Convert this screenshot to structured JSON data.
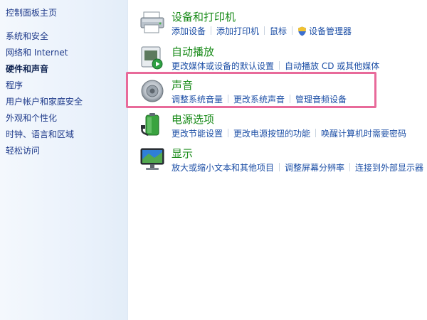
{
  "sidebar": {
    "home": "控制面板主页",
    "items": [
      {
        "label": "系统和安全"
      },
      {
        "label": "网络和 Internet"
      },
      {
        "label": "硬件和声音",
        "active": true
      },
      {
        "label": "程序"
      },
      {
        "label": "用户帐户和家庭安全"
      },
      {
        "label": "外观和个性化"
      },
      {
        "label": "时钟、语言和区域"
      },
      {
        "label": "轻松访问"
      }
    ]
  },
  "categories": {
    "devices": {
      "title": "设备和打印机",
      "icon": "printer-icon",
      "links": [
        "添加设备",
        "添加打印机",
        "鼠标",
        "设备管理器"
      ]
    },
    "autoplay": {
      "title": "自动播放",
      "icon": "autoplay-icon",
      "links": [
        "更改媒体或设备的默认设置",
        "自动播放 CD 或其他媒体"
      ]
    },
    "sound": {
      "title": "声音",
      "icon": "speaker-icon",
      "links": [
        "调整系统音量",
        "更改系统声音",
        "管理音频设备"
      ]
    },
    "power": {
      "title": "电源选项",
      "icon": "battery-icon",
      "links": [
        "更改节能设置",
        "更改电源按钮的功能",
        "唤醒计算机时需要密码"
      ]
    },
    "display": {
      "title": "显示",
      "icon": "monitor-icon",
      "links": [
        "放大或缩小文本和其他项目",
        "调整屏幕分辨率",
        "连接到外部显示器"
      ]
    }
  },
  "colors": {
    "title_green": "#1a8b1a",
    "link_blue": "#1d4fa6",
    "highlight_pink": "#e86a9a"
  }
}
